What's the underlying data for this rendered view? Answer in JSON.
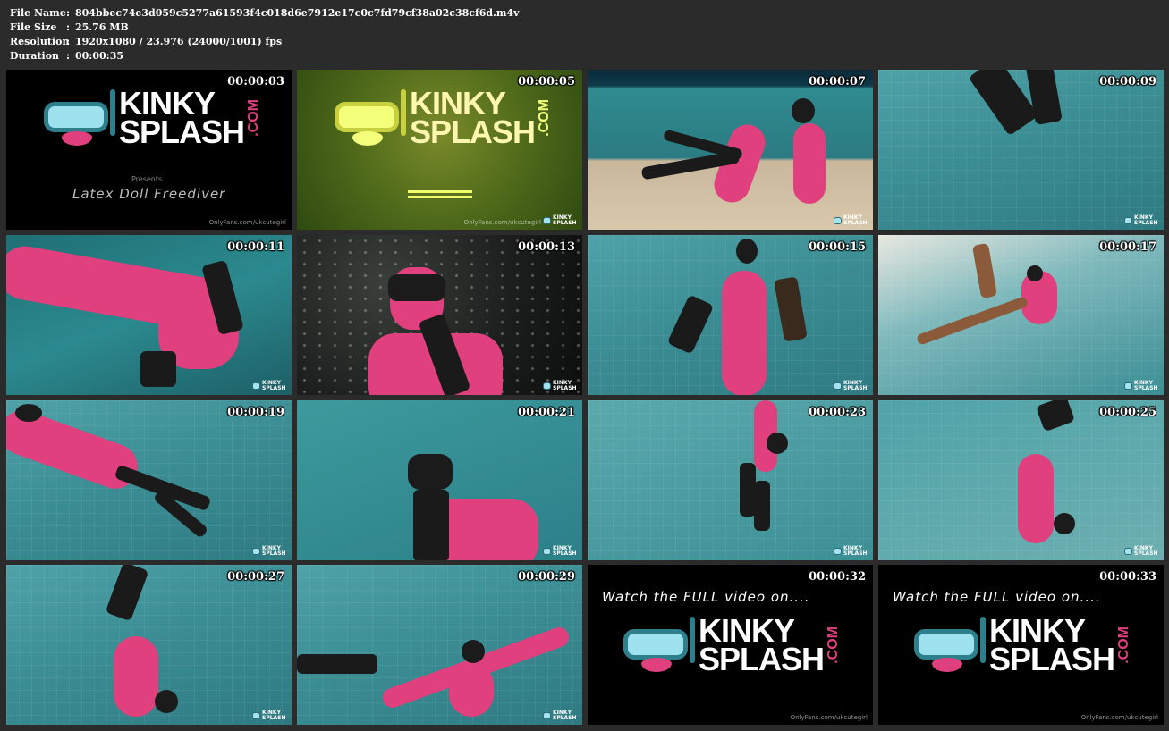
{
  "file_info": {
    "rows": [
      {
        "key": "File Name",
        "sep": ":",
        "value": "804bbec74e3d059c5277a61593f4c018d6e7912e17c0c7fd79cf38a02c38cf6d.m4v"
      },
      {
        "key": "File Size",
        "sep": ":",
        "value": "25.76 MB"
      },
      {
        "key": "Resolution",
        "sep": ":",
        "value": "1920x1080 / 23.976 (24000/1001) fps"
      },
      {
        "key": "Duration",
        "sep": ":",
        "value": "00:00:35"
      }
    ]
  },
  "thumbnails": [
    {
      "time": "00:00:03",
      "scene": "title-black"
    },
    {
      "time": "00:00:05",
      "scene": "title-green"
    },
    {
      "time": "00:00:07",
      "scene": "pool-deck"
    },
    {
      "time": "00:00:09",
      "scene": "pool"
    },
    {
      "time": "00:00:11",
      "scene": "pool"
    },
    {
      "time": "00:00:13",
      "scene": "bubbles"
    },
    {
      "time": "00:00:15",
      "scene": "pool"
    },
    {
      "time": "00:00:17",
      "scene": "pool"
    },
    {
      "time": "00:00:19",
      "scene": "pool"
    },
    {
      "time": "00:00:21",
      "scene": "pool"
    },
    {
      "time": "00:00:23",
      "scene": "pool"
    },
    {
      "time": "00:00:25",
      "scene": "pool"
    },
    {
      "time": "00:00:27",
      "scene": "pool"
    },
    {
      "time": "00:00:29",
      "scene": "pool"
    },
    {
      "time": "00:00:32",
      "scene": "cta-black"
    },
    {
      "time": "00:00:33",
      "scene": "cta-black"
    }
  ],
  "logo": {
    "line1": "KINKY",
    "line2": "SPLASH",
    "suffix": ".COM"
  },
  "title_card": {
    "presents": "Presents",
    "subtitle": "Latex Doll Freediver"
  },
  "cta_text": "Watch the FULL video on....",
  "watermark": "OnlyFans.com/ukcutegirl",
  "corner_logo": "KINKY SPLASH",
  "colors": {
    "background": "#2b2b2b",
    "brand_pink": "#e0407e",
    "mask_blue": "#9fe2ef",
    "snorkel_teal": "#2e7f8c"
  }
}
